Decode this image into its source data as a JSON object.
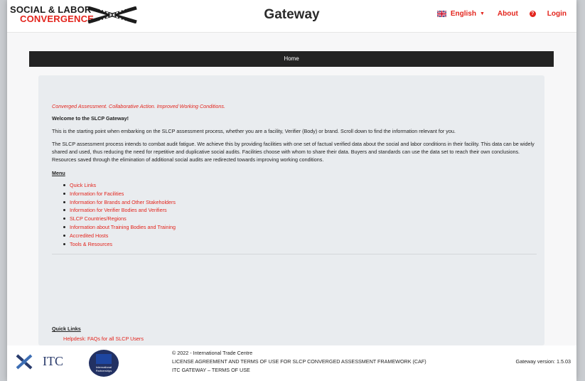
{
  "header": {
    "logo_line1": "SOCIAL & LABOR",
    "logo_line2": "CONVERGENCE",
    "title": "Gateway",
    "language": "English",
    "about": "About",
    "help_icon": "question-circle-icon",
    "login": "Login"
  },
  "nav": {
    "home": "Home"
  },
  "main": {
    "tagline": "Converged Assessment.  Collaborative Action.  Improved Working Conditions.",
    "welcome": "Welcome to the SLCP Gateway!",
    "para1": "This is the starting point when embarking on the SLCP assessment process, whether you are a facility, Verifier (Body) or brand. Scroll down to find the information relevant for you.",
    "para2": "The SLCP assessment process intends to combat audit fatigue. We achieve this by providing facilities with one set of factual verified data about the social and labor conditions in their facility. This data can be widely shared and used, thus reducing the need for repetitive and duplicative social audits. Facilities choose with whom to share their data. Buyers and standards can use the data set to reach their own conclusions. Resources saved through the elimination of additional social audits are redirected towards improving working conditions.",
    "menu_title": "Menu",
    "menu_items": [
      "Quick Links",
      "Information for Facilities",
      "Information for Brands and Other Stakeholders",
      "Information for Verifier Bodies and Verifiers",
      "SLCP Countries/Regions",
      "Information about Training Bodies and Training",
      "Accredited Hosts",
      "Tools & Resources"
    ],
    "quick_links_title": "Quick Links",
    "quick_links_first": "Helpdesk: FAQs for all SLCP Users"
  },
  "footer": {
    "itc_text": "ITC",
    "eu_text": "International Partnerships",
    "copyright": "© 2022 - International Trade Centre",
    "license": "LICENSE AGREEMENT AND TERMS OF USE FOR SLCP CONVERGED ASSESSMENT FRAMEWORK (CAF)",
    "terms": "ITC GATEWAY – TERMS OF USE",
    "version": "Gateway version: 1.5.03"
  },
  "colors": {
    "accent": "#e3241c",
    "nav_bg": "#232323",
    "panel_bg": "#e9ecef"
  }
}
